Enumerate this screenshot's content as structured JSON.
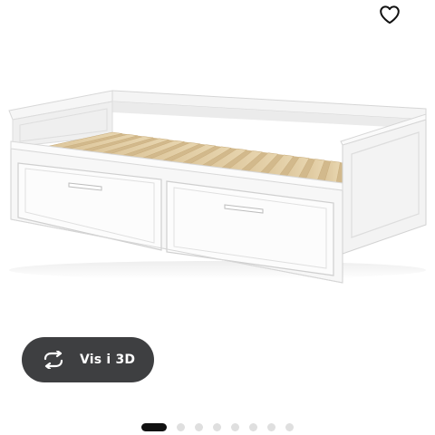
{
  "favorite": {
    "icon": "heart-outline-icon"
  },
  "product": {
    "image_icon": "white-daybed-with-two-drawers-image"
  },
  "view3d": {
    "icon": "rotate-arrows-icon",
    "label": "Vis i 3D"
  },
  "carousel": {
    "total": 8,
    "active_index": 0
  },
  "colors": {
    "button_bg": "#3e3f41",
    "dot_active": "#111111",
    "dot_inactive": "#dfdfdf"
  }
}
